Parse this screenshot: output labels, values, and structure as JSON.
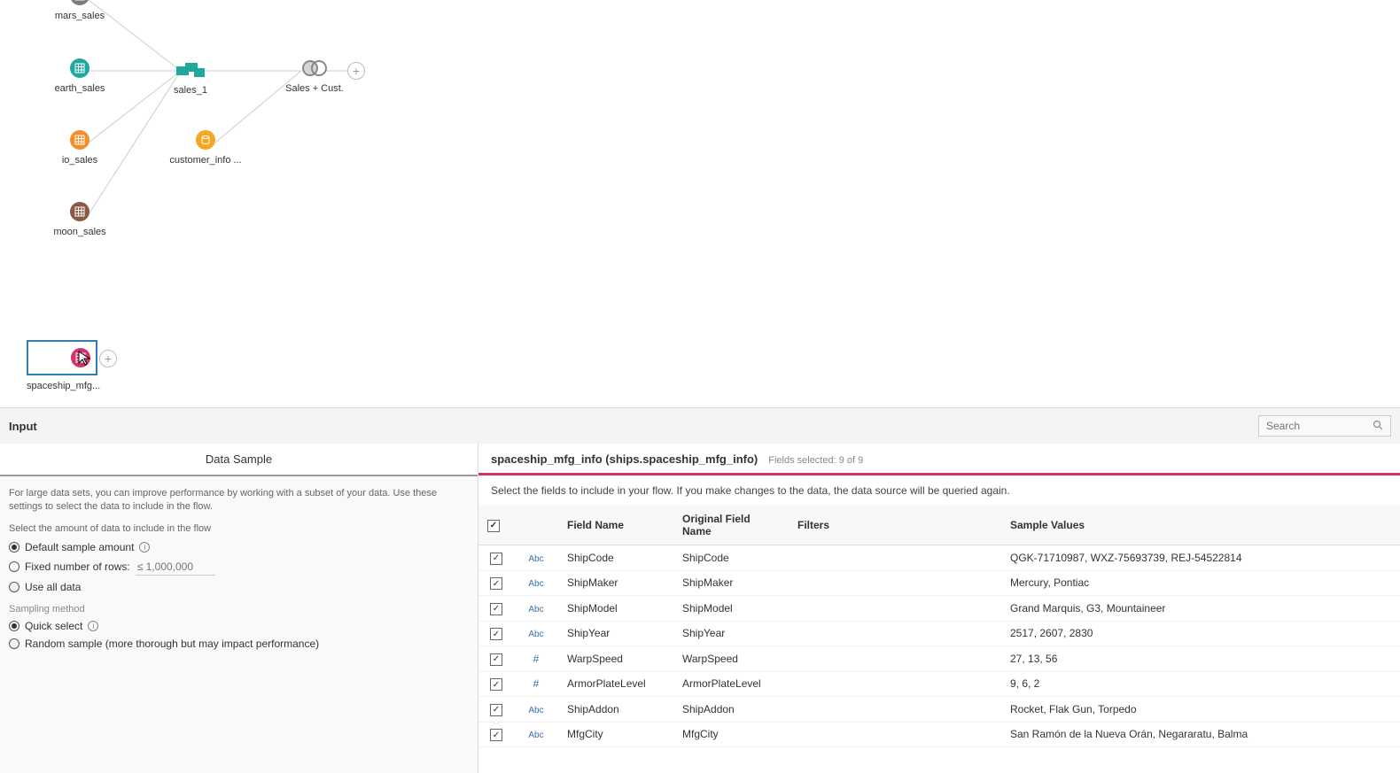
{
  "flow": {
    "nodes": {
      "mars_sales": "mars_sales",
      "earth_sales": "earth_sales",
      "io_sales": "io_sales",
      "moon_sales": "moon_sales",
      "sales_1": "sales_1",
      "customer_info": "customer_info ...",
      "sales_cust": "Sales + Cust.",
      "spaceship_mfg": "spaceship_mfg..."
    }
  },
  "panel": {
    "title": "Input",
    "search_placeholder": "Search"
  },
  "data_sample": {
    "tab_label": "Data Sample",
    "hint": "For large data sets, you can improve performance by working with a subset of your data. Use these settings to select the data to include in the flow.",
    "select_label": "Select the amount of data to include in the flow",
    "opt_default": "Default sample amount",
    "opt_fixed": "Fixed number of rows:",
    "fixed_placeholder": "≤ 1,000,000",
    "opt_all": "Use all data",
    "sampling_label": "Sampling method",
    "opt_quick": "Quick select",
    "opt_random": "Random sample (more thorough but may impact performance)"
  },
  "fields_panel": {
    "source": "spaceship_mfg_info (ships.spaceship_mfg_info)",
    "count": "Fields selected: 9 of 9",
    "hint": "Select the fields to include in your flow. If you make changes to the data, the data source will be queried again.",
    "headers": {
      "field_name": "Field Name",
      "original_name": "Original Field Name",
      "filters": "Filters",
      "samples": "Sample Values"
    },
    "rows": [
      {
        "type": "Abc",
        "name": "ShipCode",
        "orig": "ShipCode",
        "samples": "QGK-71710987, WXZ-75693739, REJ-54522814"
      },
      {
        "type": "Abc",
        "name": "ShipMaker",
        "orig": "ShipMaker",
        "samples": "Mercury, Pontiac"
      },
      {
        "type": "Abc",
        "name": "ShipModel",
        "orig": "ShipModel",
        "samples": "Grand Marquis, G3, Mountaineer"
      },
      {
        "type": "Abc",
        "name": "ShipYear",
        "orig": "ShipYear",
        "samples": "2517, 2607, 2830"
      },
      {
        "type": "#",
        "name": "WarpSpeed",
        "orig": "WarpSpeed",
        "samples": "27, 13, 56"
      },
      {
        "type": "#",
        "name": "ArmorPlateLevel",
        "orig": "ArmorPlateLevel",
        "samples": "9, 6, 2"
      },
      {
        "type": "Abc",
        "name": "ShipAddon",
        "orig": "ShipAddon",
        "samples": "Rocket, Flak Gun, Torpedo"
      },
      {
        "type": "Abc",
        "name": "MfgCity",
        "orig": "MfgCity",
        "samples": "San Ramón de la Nueva Orán, Negararatu, Balma"
      }
    ]
  }
}
